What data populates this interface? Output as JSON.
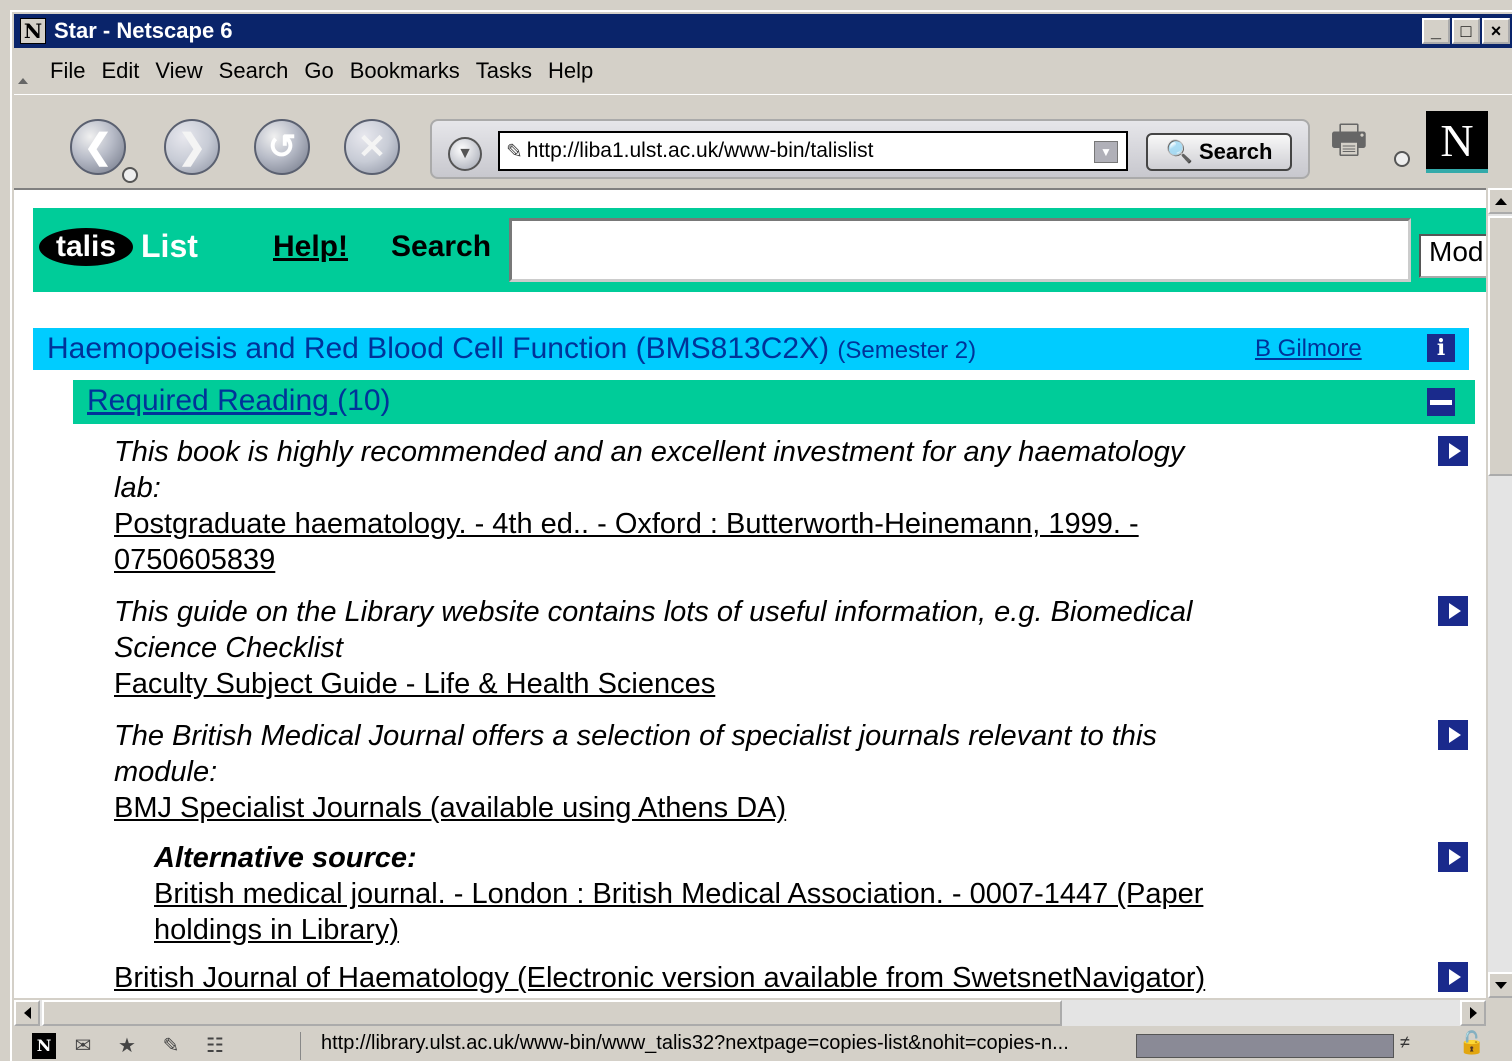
{
  "window": {
    "title": "Star - Netscape 6",
    "app_icon": "N",
    "controls": [
      "_",
      "□",
      "×"
    ]
  },
  "menu": [
    "File",
    "Edit",
    "View",
    "Search",
    "Go",
    "Bookmarks",
    "Tasks",
    "Help"
  ],
  "toolbar": {
    "url": "http://liba1.ulst.ac.uk/www-bin/talislist",
    "search_label": "Search",
    "throbber_letter": "N",
    "icons": [
      "back-icon",
      "forward-icon",
      "reload-icon",
      "stop-icon",
      "print-icon"
    ]
  },
  "talis": {
    "logo": "talis",
    "logo_suffix": "List",
    "help": "Help!",
    "search_label": "Search",
    "mode_value": "Mod"
  },
  "module": {
    "title": "Haemopoeisis and Red Blood Cell Function (BMS813C2X)",
    "semester": "(Semester 2)",
    "owner": "B Gilmore",
    "info": "i"
  },
  "section": {
    "title": "Required Reading ",
    "count": "(10)"
  },
  "items": [
    {
      "note": "This book is highly recommended and an excellent investment for any haematology lab:",
      "cite": "Postgraduate haematology. - 4th ed.. - Oxford : Butterworth-Heinemann, 1999. - 0750605839"
    },
    {
      "note": "This guide on the Library website contains lots of useful information, e.g. Biomedical Science Checklist",
      "cite": "Faculty Subject Guide - Life & Health Sciences"
    },
    {
      "note": "The British Medical Journal offers a selection of specialist journals relevant to this module:",
      "cite": "BMJ Specialist Journals (available using Athens DA)"
    },
    {
      "alt_label": "Alternative source:",
      "cite": "British medical journal. - London : British Medical Association. - 0007-1447 (Paper holdings in Library) "
    },
    {
      "cite": "British Journal of Haematology (Electronic version available from SwetsnetNavigator)"
    }
  ],
  "status": {
    "text": "http://library.ulst.ac.uk/www-bin/www_talis32?nextpage=copies-list&nohit=copies-n...",
    "icons": [
      "netscape-icon",
      "mail-icon",
      "aim-icon",
      "composer-icon",
      "address-book-icon",
      "online-icon",
      "security-lock-icon"
    ]
  }
}
